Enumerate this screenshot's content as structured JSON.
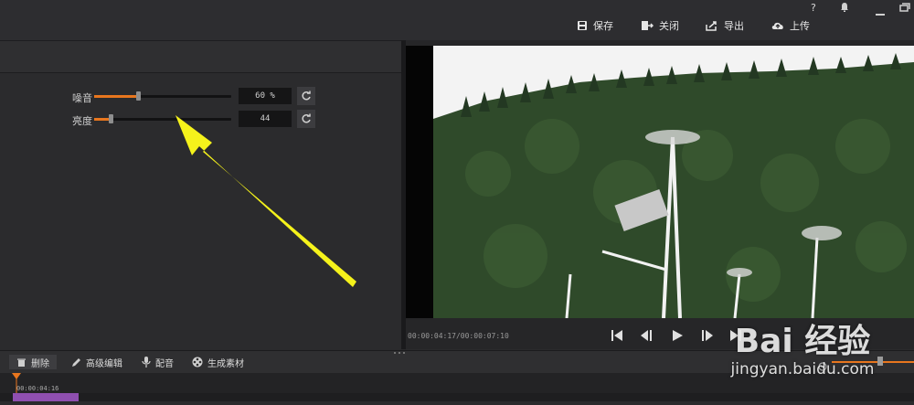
{
  "topbar": {
    "help": "?",
    "actions": [
      {
        "label": "保存",
        "icon": "save-icon"
      },
      {
        "label": "关闭",
        "icon": "exit-icon"
      },
      {
        "label": "导出",
        "icon": "export-icon"
      },
      {
        "label": "上传",
        "icon": "cloud-upload-icon"
      }
    ]
  },
  "adjust": {
    "sliders": [
      {
        "label": "噪音",
        "value_text": "60 %",
        "level": 0.32
      },
      {
        "label": "亮度",
        "value_text": "44",
        "level": 0.12
      }
    ]
  },
  "preview": {
    "timecode": "00:00:04:17/00:00:07:10"
  },
  "bottom_toolbar": {
    "delete": "删除",
    "advanced_edit": "高级编辑",
    "dub": "配音",
    "generate": "生成素材"
  },
  "timeline": {
    "playhead_time": "00:00:04:16"
  },
  "watermark": {
    "brand": "Bai 经验",
    "url": "jingyan.baidu.com"
  },
  "colors": {
    "accent": "#e8761e",
    "annotation_arrow": "#f5f21b",
    "clip": "#8f4fb0"
  }
}
